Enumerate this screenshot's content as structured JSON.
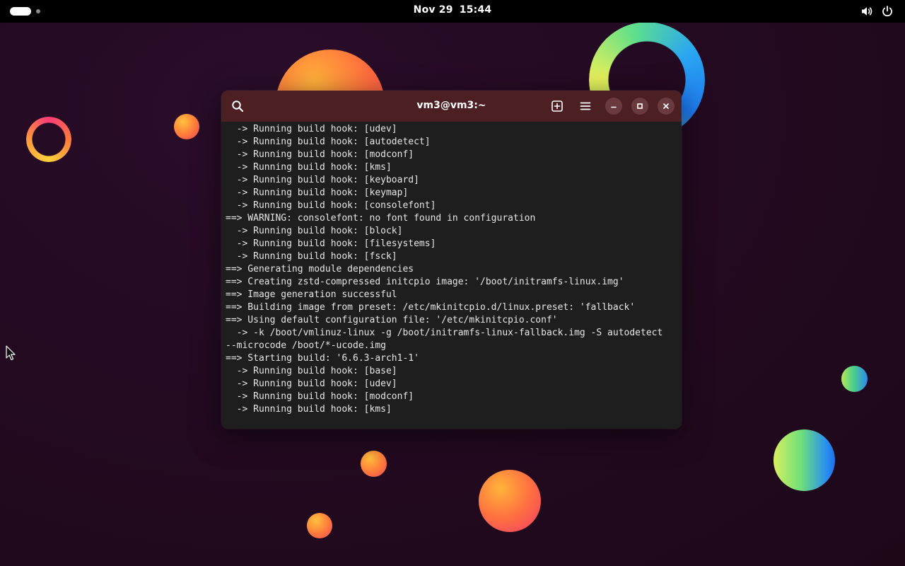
{
  "topbar": {
    "date": "Nov 29",
    "time": "15:44",
    "activities_icon": "activities-pill-icon",
    "volume_icon": "volume-icon",
    "power_icon": "power-icon"
  },
  "terminal": {
    "title": "vm3@vm3:~",
    "icons": {
      "search": "search-icon",
      "new_tab": "new-tab-icon",
      "menu": "hamburger-menu-icon",
      "minimize": "minimize-icon",
      "maximize": "maximize-icon",
      "close": "close-icon"
    },
    "colors": {
      "titlebar": "#4c1f23",
      "background": "#1e1e1e",
      "text": "#e6e6e6"
    },
    "lines": [
      "  -> Running build hook: [udev]",
      "  -> Running build hook: [autodetect]",
      "  -> Running build hook: [modconf]",
      "  -> Running build hook: [kms]",
      "  -> Running build hook: [keyboard]",
      "  -> Running build hook: [keymap]",
      "  -> Running build hook: [consolefont]",
      "==> WARNING: consolefont: no font found in configuration",
      "  -> Running build hook: [block]",
      "  -> Running build hook: [filesystems]",
      "  -> Running build hook: [fsck]",
      "==> Generating module dependencies",
      "==> Creating zstd-compressed initcpio image: '/boot/initramfs-linux.img'",
      "==> Image generation successful",
      "==> Building image from preset: /etc/mkinitcpio.d/linux.preset: 'fallback'",
      "==> Using default configuration file: '/etc/mkinitcpio.conf'",
      "  -> -k /boot/vmlinuz-linux -g /boot/initramfs-linux-fallback.img -S autodetect",
      "--microcode /boot/*-ucode.img",
      "==> Starting build: '6.6.3-arch1-1'",
      "  -> Running build hook: [base]",
      "  -> Running build hook: [udev]",
      "  -> Running build hook: [modconf]",
      "  -> Running build hook: [kms]"
    ]
  }
}
